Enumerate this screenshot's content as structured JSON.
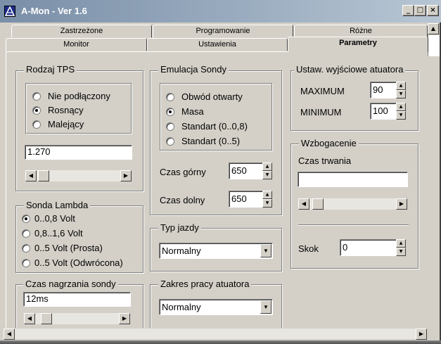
{
  "window": {
    "title": "A-Mon - Ver 1.6",
    "btn_min": "_",
    "btn_max": "□",
    "btn_close": "×"
  },
  "tabs": {
    "row1": [
      "Zastrzeżone",
      "Programowanie",
      "Różne"
    ],
    "row2": [
      "Monitor",
      "Ustawienia",
      "Parametry"
    ],
    "active": "Parametry"
  },
  "rodzaj_tps": {
    "title": "Rodzaj TPS",
    "options": [
      "Nie podłączony",
      "Rosnący",
      "Malejący"
    ],
    "selected": "Rosnący",
    "value": "1.270",
    "slider_position": 0.1
  },
  "sonda_lambda": {
    "title": "Sonda Lambda",
    "options": [
      "0..0,8 Volt",
      "0,8..1,6 Volt",
      "0..5 Volt (Prosta)",
      "0..5 Volt (Odwrócona)"
    ],
    "selected": "0..0,8 Volt"
  },
  "czas_nagrzania": {
    "title": "Czas nagrzania sondy",
    "value": "12ms",
    "slider_position": 0.12
  },
  "emulacja": {
    "title": "Emulacja Sondy",
    "options": [
      "Obwód otwarty",
      "Masa",
      "Standart (0..0,8)",
      "Standart (0..5)"
    ],
    "selected": "Masa",
    "czas_gorny_label": "Czas górny",
    "czas_gorny_value": "650",
    "czas_dolny_label": "Czas dolny",
    "czas_dolny_value": "650"
  },
  "typ_jazdy": {
    "title": "Typ jazdy",
    "value": "Normalny"
  },
  "zakres_pracy": {
    "title": "Zakres pracy atuatora",
    "value": "Normalny"
  },
  "ustaw_wyjsciowe": {
    "title": "Ustaw. wyjściowe atuatora",
    "max_label": "MAXIMUM",
    "max_value": "90",
    "min_label": "MINIMUM",
    "min_value": "100"
  },
  "wzbogacenie": {
    "title": "Wzbogacenie",
    "czas_label": "Czas trwania",
    "czas_value": "",
    "slider_position": 0.1,
    "skok_label": "Skok",
    "skok_value": "0"
  }
}
